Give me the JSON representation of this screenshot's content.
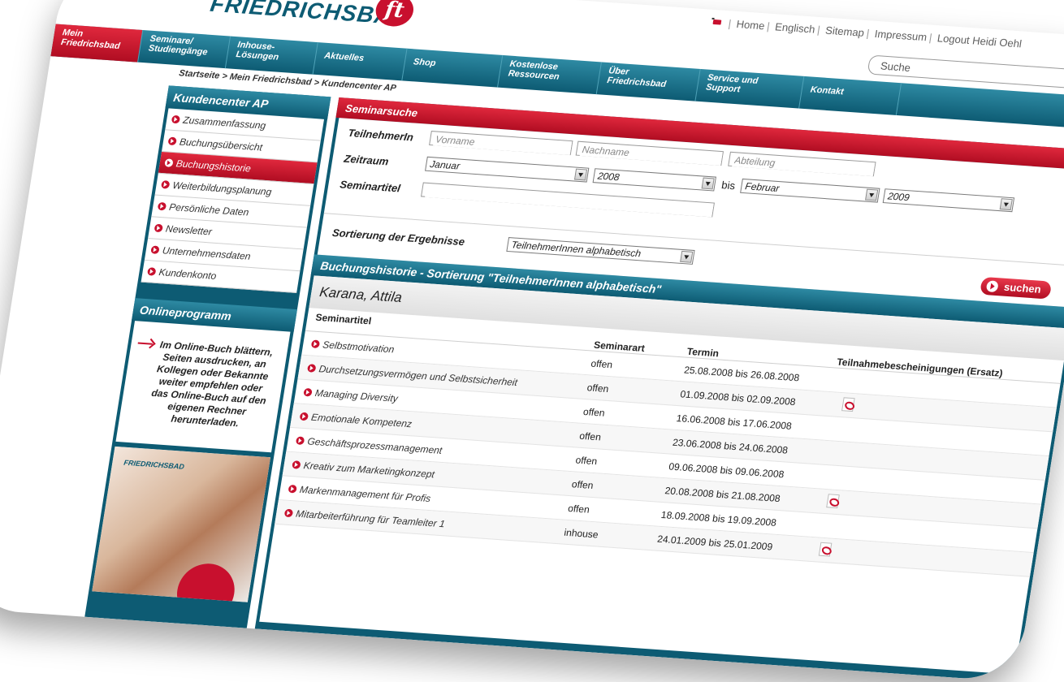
{
  "header": {
    "logo_text": "FRIEDRICHSBAD",
    "logo_badge": "ft",
    "top_links": [
      "Home",
      "Englisch",
      "Sitemap",
      "Impressum",
      "Logout Heidi Oehl"
    ],
    "search_placeholder": "Suche"
  },
  "nav": {
    "items": [
      "Mein\nFriedrichsbad",
      "Seminare/\nStudiengänge",
      "Inhouse-\nLösungen",
      "Aktuelles",
      "Shop",
      "Kostenlose\nRessourcen",
      "Über\nFriedrichsbad",
      "Service und\nSupport",
      "Kontakt"
    ]
  },
  "breadcrumb": "Startseite > Mein Friedrichsbad > Kundencenter AP",
  "sidebar": {
    "title": "Kundencenter AP",
    "items": [
      "Zusammenfassung",
      "Buchungsübersicht",
      "Buchungshistorie",
      "Weiterbildungsplanung",
      "Persönliche Daten",
      "Newsletter",
      "Unternehmensdaten",
      "Kundenkonto"
    ],
    "online_title": "Onlineprogramm",
    "online_text": "Im Online-Buch blättern, Seiten ausdrucken, an Kollegen oder Bekannte weiter empfehlen oder das Online-Buch auf den eigenen Rechner herunterladen.",
    "promo_logo": "FRIEDRICHSBAD"
  },
  "search": {
    "title": "Seminarsuche",
    "participant_label": "TeilnehmerIn",
    "first_name_placeholder": "Vorname",
    "last_name_placeholder": "Nachname",
    "department_placeholder": "Abteilung",
    "period_label": "Zeitraum",
    "from_month": "Januar",
    "from_year": "2008",
    "to_label": "bis",
    "to_month": "Februar",
    "to_year": "2009",
    "title_label": "Seminartitel",
    "sort_label": "Sortierung der Ergebnisse",
    "sort_value": "TeilnehmerInnen alphabetisch",
    "button": "suchen"
  },
  "history": {
    "title": "Buchungshistorie - Sortierung \"TeilnehmerInnen alphabetisch\"",
    "person": "Karana, Attila",
    "columns": [
      "Seminartitel",
      "Seminarart",
      "Termin",
      "Teilnahmebescheinigungen (Ersatz)"
    ],
    "rows": [
      {
        "title": "Selbstmotivation",
        "art": "offen",
        "termin": "25.08.2008 bis 26.08.2008",
        "pdf": false
      },
      {
        "title": "Durchsetzungsvermögen und Selbstsicherheit",
        "art": "offen",
        "termin": "01.09.2008 bis 02.09.2008",
        "pdf": true
      },
      {
        "title": "Managing Diversity",
        "art": "offen",
        "termin": "16.06.2008 bis 17.06.2008",
        "pdf": false
      },
      {
        "title": "Emotionale Kompetenz",
        "art": "offen",
        "termin": "23.06.2008 bis 24.06.2008",
        "pdf": false
      },
      {
        "title": "Geschäftsprozessmanagement",
        "art": "offen",
        "termin": "09.06.2008 bis 09.06.2008",
        "pdf": false
      },
      {
        "title": "Kreativ zum Marketingkonzept",
        "art": "offen",
        "termin": "20.08.2008 bis 21.08.2008",
        "pdf": true
      },
      {
        "title": "Markenmanagement für Profis",
        "art": "offen",
        "termin": "18.09.2008 bis 19.09.2008",
        "pdf": false
      },
      {
        "title": "Mitarbeiterführung für Teamleiter 1",
        "art": "inhouse",
        "termin": "24.01.2009 bis 25.01.2009",
        "pdf": true
      }
    ]
  }
}
